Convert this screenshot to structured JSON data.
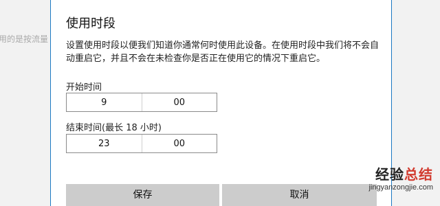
{
  "background_snippet": "用的是按流量",
  "dialog": {
    "title": "使用时段",
    "description": "设置使用时段以便我们知道你通常何时使用此设备。在使用时段中我们将不会自动重启它，并且不会在未检查你是否正在使用它的情况下重启它。",
    "start": {
      "label": "开始时间",
      "hour": "9",
      "minute": "00"
    },
    "end": {
      "label": "结束时间(最长 18 小时)",
      "hour": "23",
      "minute": "00"
    },
    "buttons": {
      "save": "保存",
      "cancel": "取消"
    }
  },
  "watermark": {
    "title_part1": "经验",
    "title_part2": "总结",
    "url": "jingyanzongjie.com"
  },
  "colors": {
    "dialog_border": "#1a78c2",
    "button_bg": "#cccccc",
    "watermark_accent": "#d23b2f"
  }
}
